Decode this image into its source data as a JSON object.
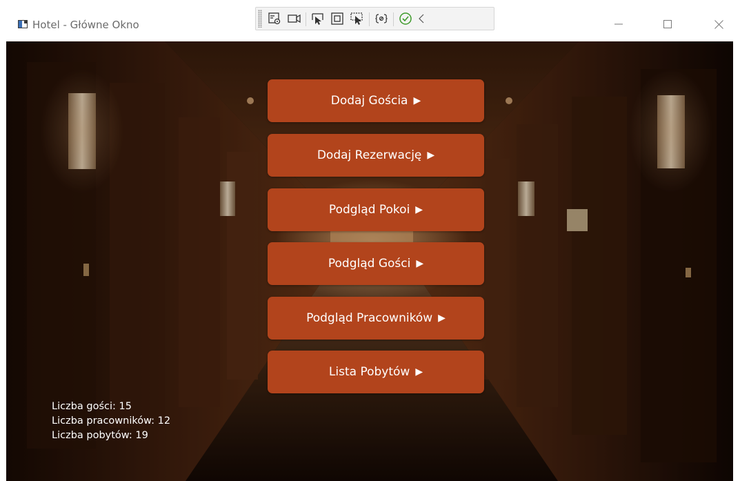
{
  "window": {
    "title": "Hotel - Główne Okno",
    "controls": [
      "minimize-icon",
      "maximize-icon",
      "close-icon"
    ]
  },
  "dev_toolbar": {
    "tools": [
      "live-visual-tree-icon",
      "record-icon",
      "select-element-icon",
      "display-layout-adorners-icon",
      "track-focus-icon",
      "binding-failures-icon",
      "hot-reload-check-icon",
      "collapse-chevron-icon"
    ]
  },
  "menu": {
    "buttons": [
      {
        "label": "Dodaj Gościa",
        "arrow": "▶"
      },
      {
        "label": "Dodaj Rezerwację",
        "arrow": "▶"
      },
      {
        "label": "Podgląd Pokoi",
        "arrow": "▶"
      },
      {
        "label": "Podgląd Gości",
        "arrow": "▶"
      },
      {
        "label": "Podgląd Pracowników",
        "arrow": "▶"
      },
      {
        "label": "Lista Pobytów",
        "arrow": "▶"
      }
    ]
  },
  "stats": {
    "guests": "Liczba gości: 15",
    "employees": "Liczba pracowników: 12",
    "stays": "Liczba pobytów: 19"
  },
  "colors": {
    "button_bg": "#b2441c",
    "button_text": "#ffffff",
    "background_dark": "#1a0c05",
    "wall_wood": "#5a2c12",
    "lamp_glow": "#f3dcc0"
  }
}
